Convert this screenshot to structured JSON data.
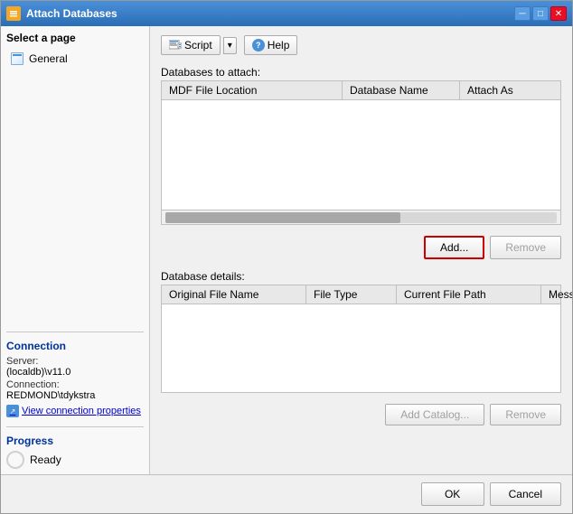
{
  "window": {
    "title": "Attach Databases",
    "icon": "🗄"
  },
  "titlebar": {
    "minimize_label": "─",
    "maximize_label": "□",
    "close_label": "✕"
  },
  "sidebar": {
    "select_page_label": "Select a page",
    "items": [
      {
        "id": "general",
        "label": "General"
      }
    ]
  },
  "connection": {
    "section_title": "Connection",
    "server_label": "Server:",
    "server_value": "(localdb)\\v11.0",
    "connection_label": "Connection:",
    "connection_value": "REDMOND\\tdykstra",
    "view_link": "View connection properties"
  },
  "progress": {
    "section_title": "Progress",
    "status": "Ready"
  },
  "toolbar": {
    "script_label": "Script",
    "help_label": "Help"
  },
  "databases_section": {
    "label": "Databases to attach:",
    "columns": [
      "MDF File Location",
      "Database Name",
      "Attach As",
      ""
    ],
    "add_button": "Add...",
    "remove_button": "Remove"
  },
  "details_section": {
    "label": "Database details:",
    "columns": [
      "Original File Name",
      "File Type",
      "Current File Path",
      "Message"
    ],
    "add_catalog_button": "Add Catalog...",
    "remove_button": "Remove"
  },
  "footer": {
    "ok_button": "OK",
    "cancel_button": "Cancel"
  }
}
